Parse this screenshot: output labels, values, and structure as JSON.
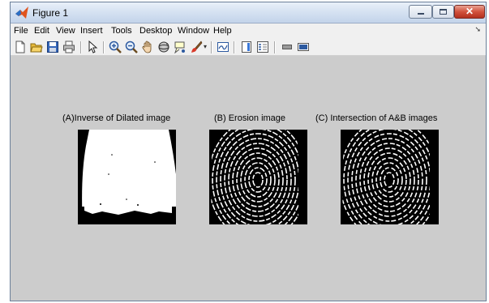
{
  "window": {
    "title": "Figure 1",
    "controls": {
      "minimize": "minimize",
      "maximize": "maximize",
      "close": "✕"
    }
  },
  "menubar": [
    "File",
    "Edit",
    "View",
    "Insert",
    "Tools",
    "Desktop",
    "Window",
    "Help"
  ],
  "toolbar": {
    "icons": [
      "new-figure-icon",
      "open-file-icon",
      "save-icon",
      "print-icon",
      "pointer-icon",
      "zoom-in-icon",
      "zoom-out-icon",
      "pan-icon",
      "rotate-3d-icon",
      "data-cursor-icon",
      "brush-icon",
      "link-plot-icon",
      "colorbar-icon",
      "legend-icon",
      "hide-plot-tools-icon",
      "show-plot-tools-icon"
    ]
  },
  "axes": [
    {
      "title": "(A)Inverse of Dilated image",
      "image": "Inverse of dilated fingerprint (mostly white)"
    },
    {
      "title": "(B) Erosion image",
      "image": "Eroded fingerprint ridges"
    },
    {
      "title": "(C) Intersection of A&B images",
      "image": "Intersection fingerprint ridges"
    }
  ],
  "colors": {
    "canvas": "#cccccc",
    "menubar": "#f0f0f0",
    "titlebar": "#d6e2f2",
    "close_button": "#c8412f"
  }
}
